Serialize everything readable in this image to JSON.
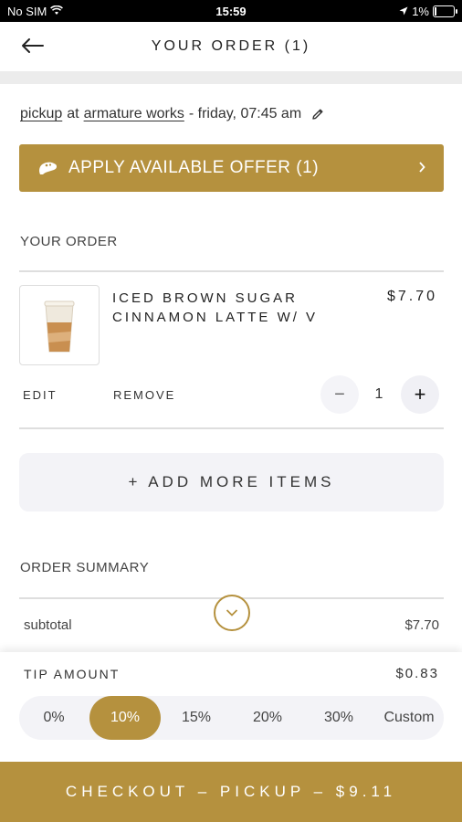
{
  "status_bar": {
    "carrier": "No SIM",
    "time": "15:59",
    "battery": "1%"
  },
  "header": {
    "title": "YOUR ORDER (1)"
  },
  "pickup": {
    "mode": "pickup",
    "at": "at",
    "location": "armature works",
    "time": "- friday, 07:45 am"
  },
  "offer": {
    "label": "APPLY AVAILABLE OFFER (1)"
  },
  "order": {
    "section_label": "YOUR ORDER",
    "item": {
      "name": "ICED BROWN SUGAR CINNAMON LATTE W/ V",
      "price": "$7.70",
      "edit_label": "EDIT",
      "remove_label": "REMOVE",
      "quantity": "1",
      "minus": "−",
      "plus": "+"
    },
    "add_more_label": "+ ADD MORE ITEMS"
  },
  "summary": {
    "section_label": "ORDER SUMMARY",
    "subtotal_label": "subtotal",
    "subtotal_value": "$7.70"
  },
  "tip": {
    "label": "TIP AMOUNT",
    "amount": "$0.83",
    "options": [
      "0%",
      "10%",
      "15%",
      "20%",
      "30%",
      "Custom"
    ],
    "selected": "10%"
  },
  "checkout": {
    "label": "CHECKOUT – PICKUP – $9.11"
  },
  "colors": {
    "accent": "#b5913e",
    "light_bg": "#f3f3f7"
  }
}
